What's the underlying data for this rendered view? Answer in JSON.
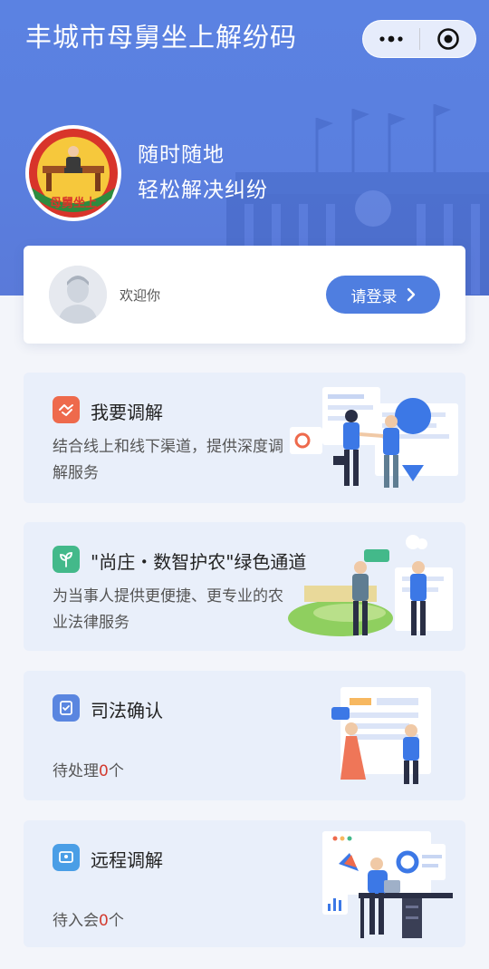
{
  "app": {
    "title": "丰城市母舅坐上解纷码"
  },
  "capsule": {
    "menu_icon": "more-dots-icon",
    "close_icon": "target-close-icon"
  },
  "hero": {
    "slogan_line1": "随时随地",
    "slogan_line2": "轻松解决纠纷",
    "logo_text": "母舅坐上"
  },
  "user": {
    "welcome": "欢迎你",
    "login_label": "请登录"
  },
  "cards": [
    {
      "title": "我要调解",
      "desc": "结合线上和线下渠道，提供深度调解服务",
      "icon": "handshake-icon",
      "icon_color": "#ee6a4c"
    },
    {
      "title": "\"尚庄・数智护农\"绿色通道",
      "desc": "为当事人提供更便捷、更专业的农业法律服务",
      "icon": "sprout-icon",
      "icon_color": "#43b98a"
    },
    {
      "title": "司法确认",
      "count_prefix": "待处理",
      "count": "0",
      "count_suffix": "个",
      "icon": "document-check-icon",
      "icon_color": "#5a86e0"
    },
    {
      "title": "远程调解",
      "count_prefix": "待入会",
      "count": "0",
      "count_suffix": "个",
      "icon": "video-screen-icon",
      "icon_color": "#4a9ee6"
    }
  ],
  "colors": {
    "primary": "#4f7ee0",
    "hero_bg": "#5b82e2",
    "count_red": "#d23a2e"
  }
}
